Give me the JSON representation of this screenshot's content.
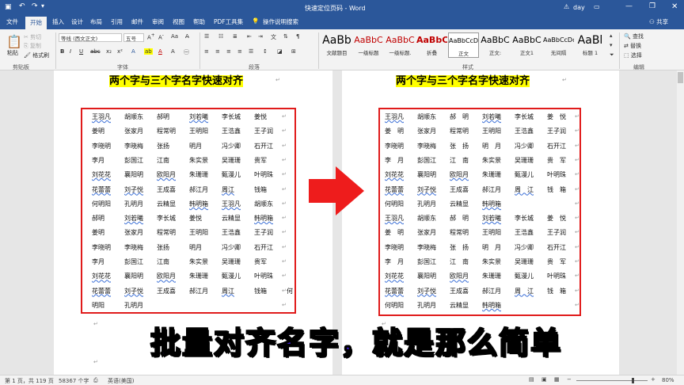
{
  "window": {
    "title": "快速定位页码 - Word",
    "user": "day"
  },
  "tabs": [
    "文件",
    "开始",
    "插入",
    "设计",
    "布局",
    "引用",
    "邮件",
    "审阅",
    "视图",
    "帮助",
    "PDF工具集"
  ],
  "tell_me": "操作说明搜索",
  "share": "共享",
  "clipboard": {
    "paste": "粘贴",
    "cut": "剪切",
    "copy": "复制",
    "painter": "格式刷",
    "label": "剪贴板"
  },
  "font": {
    "name": "等线 (西文正文)",
    "size": "五号",
    "label": "字体"
  },
  "paragraph": {
    "label": "段落"
  },
  "styles": {
    "label": "样式",
    "items": [
      {
        "sample": "AaBb",
        "name": "文献题目",
        "color": "#000"
      },
      {
        "sample": "AaBbC",
        "name": "一级标题",
        "color": "#c00000"
      },
      {
        "sample": "AaBbC",
        "name": "一级标题.",
        "color": "#c00000"
      },
      {
        "sample": "AaBbC",
        "name": "折叠",
        "color": "#c00000"
      },
      {
        "sample": "AaBbCcDc",
        "name": "正文",
        "color": "#000"
      },
      {
        "sample": "AaBbC",
        "name": "正文:",
        "color": "#000"
      },
      {
        "sample": "AaBbC",
        "name": "正文1",
        "color": "#000"
      },
      {
        "sample": "AaBbCcDc",
        "name": "无间隔",
        "color": "#000"
      },
      {
        "sample": "AaBl",
        "name": "标题 1",
        "color": "#000"
      }
    ]
  },
  "editing": {
    "find": "查找",
    "replace": "替换",
    "select": "选择",
    "label": "编辑"
  },
  "doc_title": "两个字与三个字名字快速对齐",
  "left_rows": [
    [
      "王羽凡",
      "胡顺东",
      "郝明",
      "刘若曦",
      "李长城",
      "姜悦"
    ],
    [
      "姜明",
      "张家月",
      "程常明",
      "王明阳",
      "王浩鑫",
      "王子润"
    ],
    [
      "李晓明",
      "李晓梅",
      "张扬",
      "明月",
      "冯少卿",
      "石开江"
    ],
    [
      "李月",
      "彭国江",
      "江南",
      "朱实景",
      "吴珊珊",
      "贵军"
    ],
    [
      "刘花花",
      "襄阳明",
      "欧阳月",
      "朱珊珊",
      "甄漫儿",
      "叶明珠"
    ],
    [
      "花蕾蕾",
      "刘子悦",
      "王成喜",
      "郝江月",
      "周江",
      "钱箱"
    ],
    [
      "何明阳",
      "孔明月",
      "云精显",
      "韩明箱",
      "王羽凡",
      "胡顺东"
    ],
    [
      "郝明",
      "刘若曦",
      "李长城",
      "姜悦",
      "云精显",
      "韩明箱"
    ],
    [
      "姜明",
      "张家月",
      "程常明",
      "王明阳",
      "王浩鑫",
      "王子润"
    ],
    [
      "李晓明",
      "李晓梅",
      "张扬",
      "明月",
      "冯少卿",
      "石开江"
    ],
    [
      "李月",
      "彭国江",
      "江南",
      "朱实景",
      "吴珊珊",
      "贵军"
    ],
    [
      "刘花花",
      "襄阳明",
      "欧阳月",
      "朱珊珊",
      "甄漫儿",
      "叶明珠"
    ],
    [
      "花蕾蕾",
      "刘子悦",
      "王成喜",
      "郝江月",
      "周江",
      "钱箱",
      "何"
    ],
    [
      "明阳",
      "孔明月"
    ]
  ],
  "right_rows": [
    [
      "王羽凡",
      "胡顺东",
      "郝　明",
      "刘若曦",
      "李长城",
      "姜　悦"
    ],
    [
      "姜　明",
      "张家月",
      "程常明",
      "王明阳",
      "王浩鑫",
      "王子润"
    ],
    [
      "李晓明",
      "李晓梅",
      "张　扬",
      "明　月",
      "冯少卿",
      "石开江"
    ],
    [
      "李　月",
      "彭国江",
      "江　南",
      "朱实景",
      "吴珊珊",
      "贵　军"
    ],
    [
      "刘花花",
      "襄阳明",
      "欧阳月",
      "朱珊珊",
      "甄漫儿",
      "叶明珠"
    ],
    [
      "花蕾蕾",
      "刘子悦",
      "王成喜",
      "郝江月",
      "周　江",
      "钱　箱"
    ],
    [
      "何明阳",
      "孔明月",
      "云精显",
      "韩明箱"
    ],
    [
      "王羽凡",
      "胡顺东",
      "郝　明",
      "刘若曦",
      "李长城",
      "姜　悦"
    ],
    [
      "姜　明",
      "张家月",
      "程常明",
      "王明阳",
      "王浩鑫",
      "王子润"
    ],
    [
      "李晓明",
      "李晓梅",
      "张　扬",
      "明　月",
      "冯少卿",
      "石开江"
    ],
    [
      "李　月",
      "彭国江",
      "江　南",
      "朱实景",
      "吴珊珊",
      "贵　军"
    ],
    [
      "刘花花",
      "襄阳明",
      "欧阳月",
      "朱珊珊",
      "甄漫儿",
      "叶明珠"
    ],
    [
      "花蕾蕾",
      "刘子悦",
      "王成喜",
      "郝江月",
      "周　江",
      "钱　箱"
    ],
    [
      "何明阳",
      "孔明月",
      "云精显",
      "韩明箱"
    ]
  ],
  "caption": "批量对齐名字，就是那么简单",
  "status": {
    "page": "第 1 页，共 119 页",
    "words": "58367 个字",
    "lang": "英语(美国)",
    "zoom": "80%"
  },
  "colors": {
    "accent": "#2b579a",
    "highlight": "#ffff00",
    "frame": "#e01b1b",
    "arrow": "#ee1c1c",
    "caption": "#3d1bd6"
  }
}
